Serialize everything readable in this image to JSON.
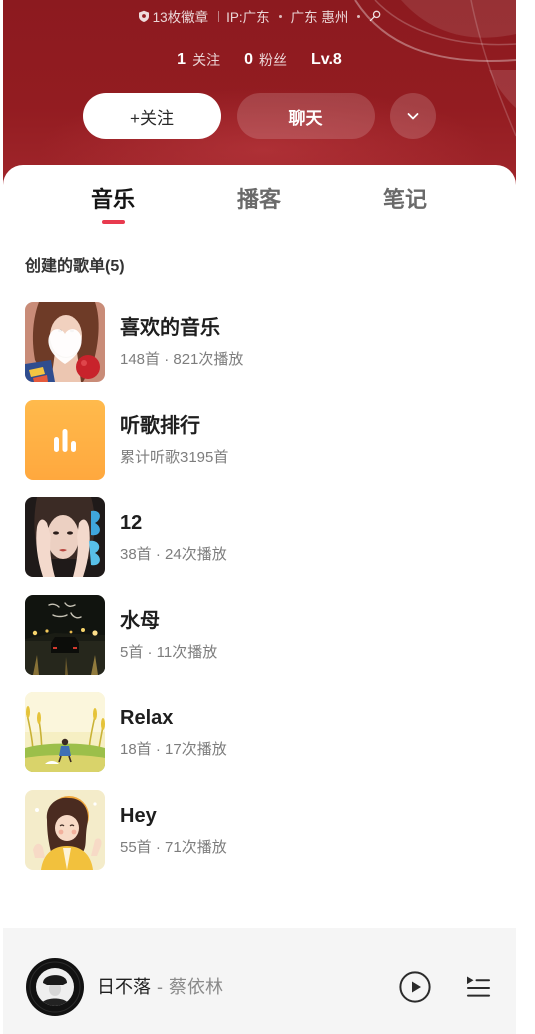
{
  "header": {
    "badge_count_text": "13枚徽章",
    "ip_text": "IP:广东",
    "location_text": "广东 惠州",
    "following_count": "1",
    "following_label": "关注",
    "followers_count": "0",
    "followers_label": "粉丝",
    "level": "Lv.8",
    "follow_button_label": "+关注",
    "chat_button_label": "聊天",
    "icons": {
      "badge": "badge-icon",
      "gender": "gender-icon",
      "more": "chevron-down-icon"
    }
  },
  "tabs": [
    {
      "label": "音乐",
      "active": true
    },
    {
      "label": "播客",
      "active": false
    },
    {
      "label": "笔记",
      "active": false
    }
  ],
  "playlists_section": {
    "title": "创建的歌单(5)",
    "items": [
      {
        "title": "喜欢的音乐",
        "subtitle": "148首 · 821次播放"
      },
      {
        "title": "听歌排行",
        "subtitle": "累计听歌3195首",
        "icon": "bar-chart-icon"
      },
      {
        "title": "12",
        "subtitle": "38首 · 24次播放"
      },
      {
        "title": "水母",
        "subtitle": "5首 · 11次播放"
      },
      {
        "title": "Relax",
        "subtitle": "18首 · 17次播放"
      },
      {
        "title": "Hey",
        "subtitle": "55首 · 71次播放"
      }
    ]
  },
  "player": {
    "song": "日不落",
    "separator": "-",
    "artist": "蔡依林",
    "icons": {
      "play": "play-icon",
      "playlist": "playlist-icon"
    }
  },
  "colors": {
    "header_bg": "#941d22",
    "accent": "#e83a4e",
    "card_bg": "#ffffff",
    "player_bg": "#f5f5f5"
  }
}
